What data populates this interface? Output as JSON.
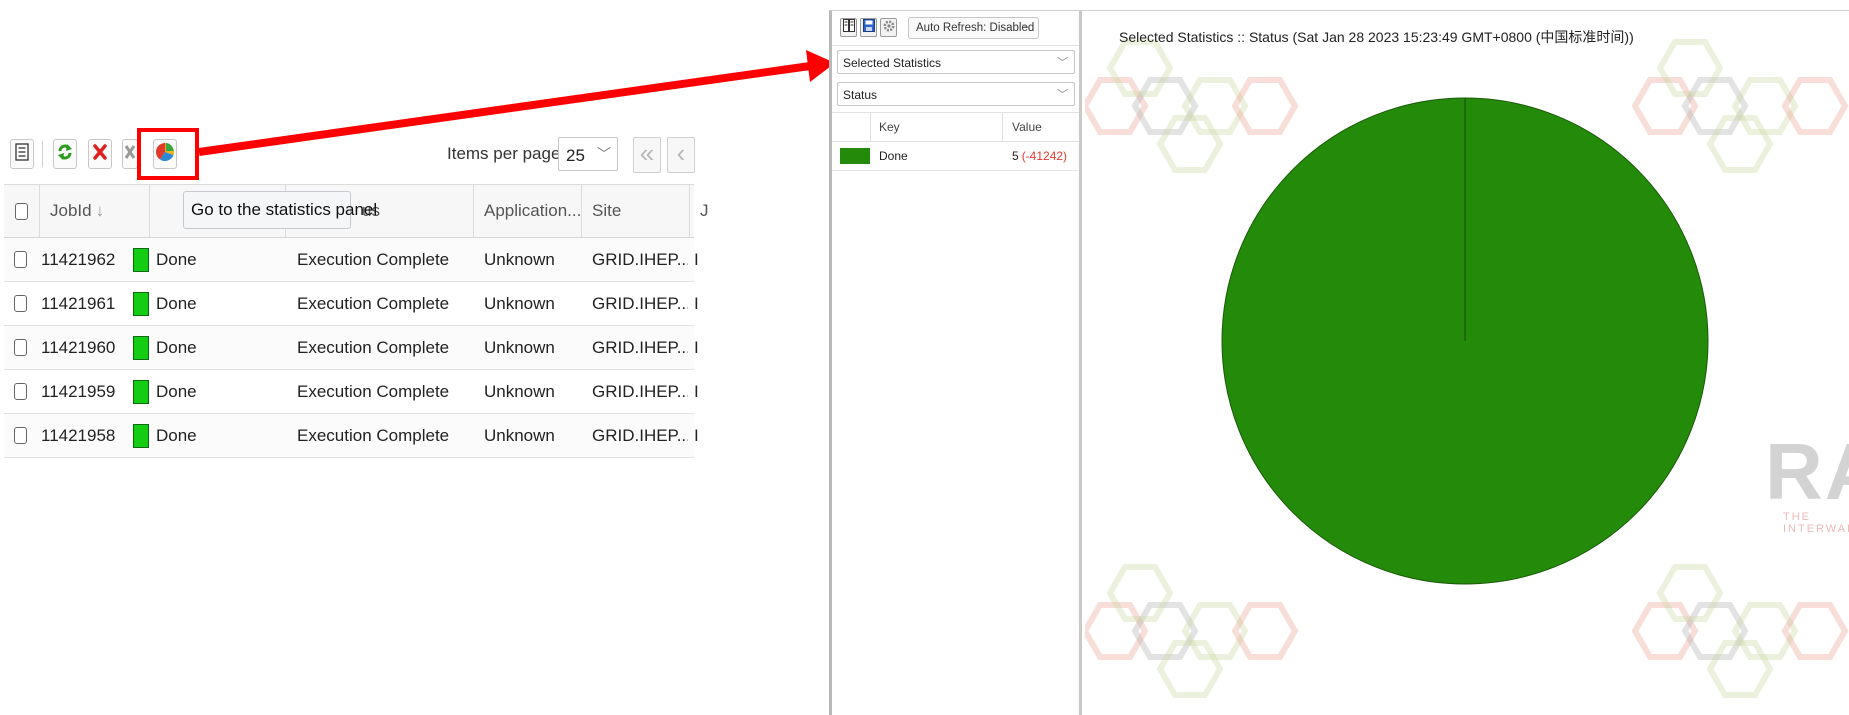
{
  "job_monitor": {
    "toolbar": {
      "icons": [
        "list-icon",
        "refresh-icon",
        "delete-icon",
        "kill-icon",
        "pie-chart-icon"
      ],
      "items_per_page_label": "Items per page:",
      "items_per_page_value": "25"
    },
    "tooltip": "Go to the statistics panel",
    "columns": [
      "JobId",
      "",
      "Status",
      "Application...",
      "Site",
      "J"
    ],
    "header_partial_status": "us",
    "rows": [
      {
        "job_id": "11421962",
        "status": "Done",
        "minor_status": "Execution Complete",
        "application": "Unknown",
        "site": "GRID.IHEP...",
        "extra": "I"
      },
      {
        "job_id": "11421961",
        "status": "Done",
        "minor_status": "Execution Complete",
        "application": "Unknown",
        "site": "GRID.IHEP...",
        "extra": "I"
      },
      {
        "job_id": "11421960",
        "status": "Done",
        "minor_status": "Execution Complete",
        "application": "Unknown",
        "site": "GRID.IHEP...",
        "extra": "I"
      },
      {
        "job_id": "11421959",
        "status": "Done",
        "minor_status": "Execution Complete",
        "application": "Unknown",
        "site": "GRID.IHEP...",
        "extra": "I"
      },
      {
        "job_id": "11421958",
        "status": "Done",
        "minor_status": "Execution Complete",
        "application": "Unknown",
        "site": "GRID.IHEP...",
        "extra": "I"
      }
    ],
    "colors": {
      "done_status": "#15cc15",
      "highlight": "#ff0000"
    }
  },
  "stats_panel": {
    "toolbar": {
      "icons": [
        "columns-icon",
        "save-icon",
        "settings-icon"
      ],
      "auto_refresh": "Auto Refresh: Disabled"
    },
    "selection_select": "Selected Statistics",
    "category_select": "Status",
    "key_table": {
      "headers": {
        "key": "Key",
        "value": "Value"
      },
      "rows": [
        {
          "key": "Done",
          "value": "5",
          "delta": "(-41242)",
          "color": "#238b09"
        }
      ]
    },
    "chart_title": "Selected Statistics :: Status (Sat Jan 28 2023 15:23:49 GMT+0800 (中国标准时间))",
    "watermark": {
      "text": "RAC",
      "subtext": "THE INTERWAR"
    }
  },
  "chart_data": {
    "type": "pie",
    "title": "Selected Statistics :: Status (Sat Jan 28 2023 15:23:49 GMT+0800 (中国标准时间))",
    "categories": [
      "Done"
    ],
    "values": [
      5
    ],
    "colors": [
      "#238b09"
    ]
  }
}
